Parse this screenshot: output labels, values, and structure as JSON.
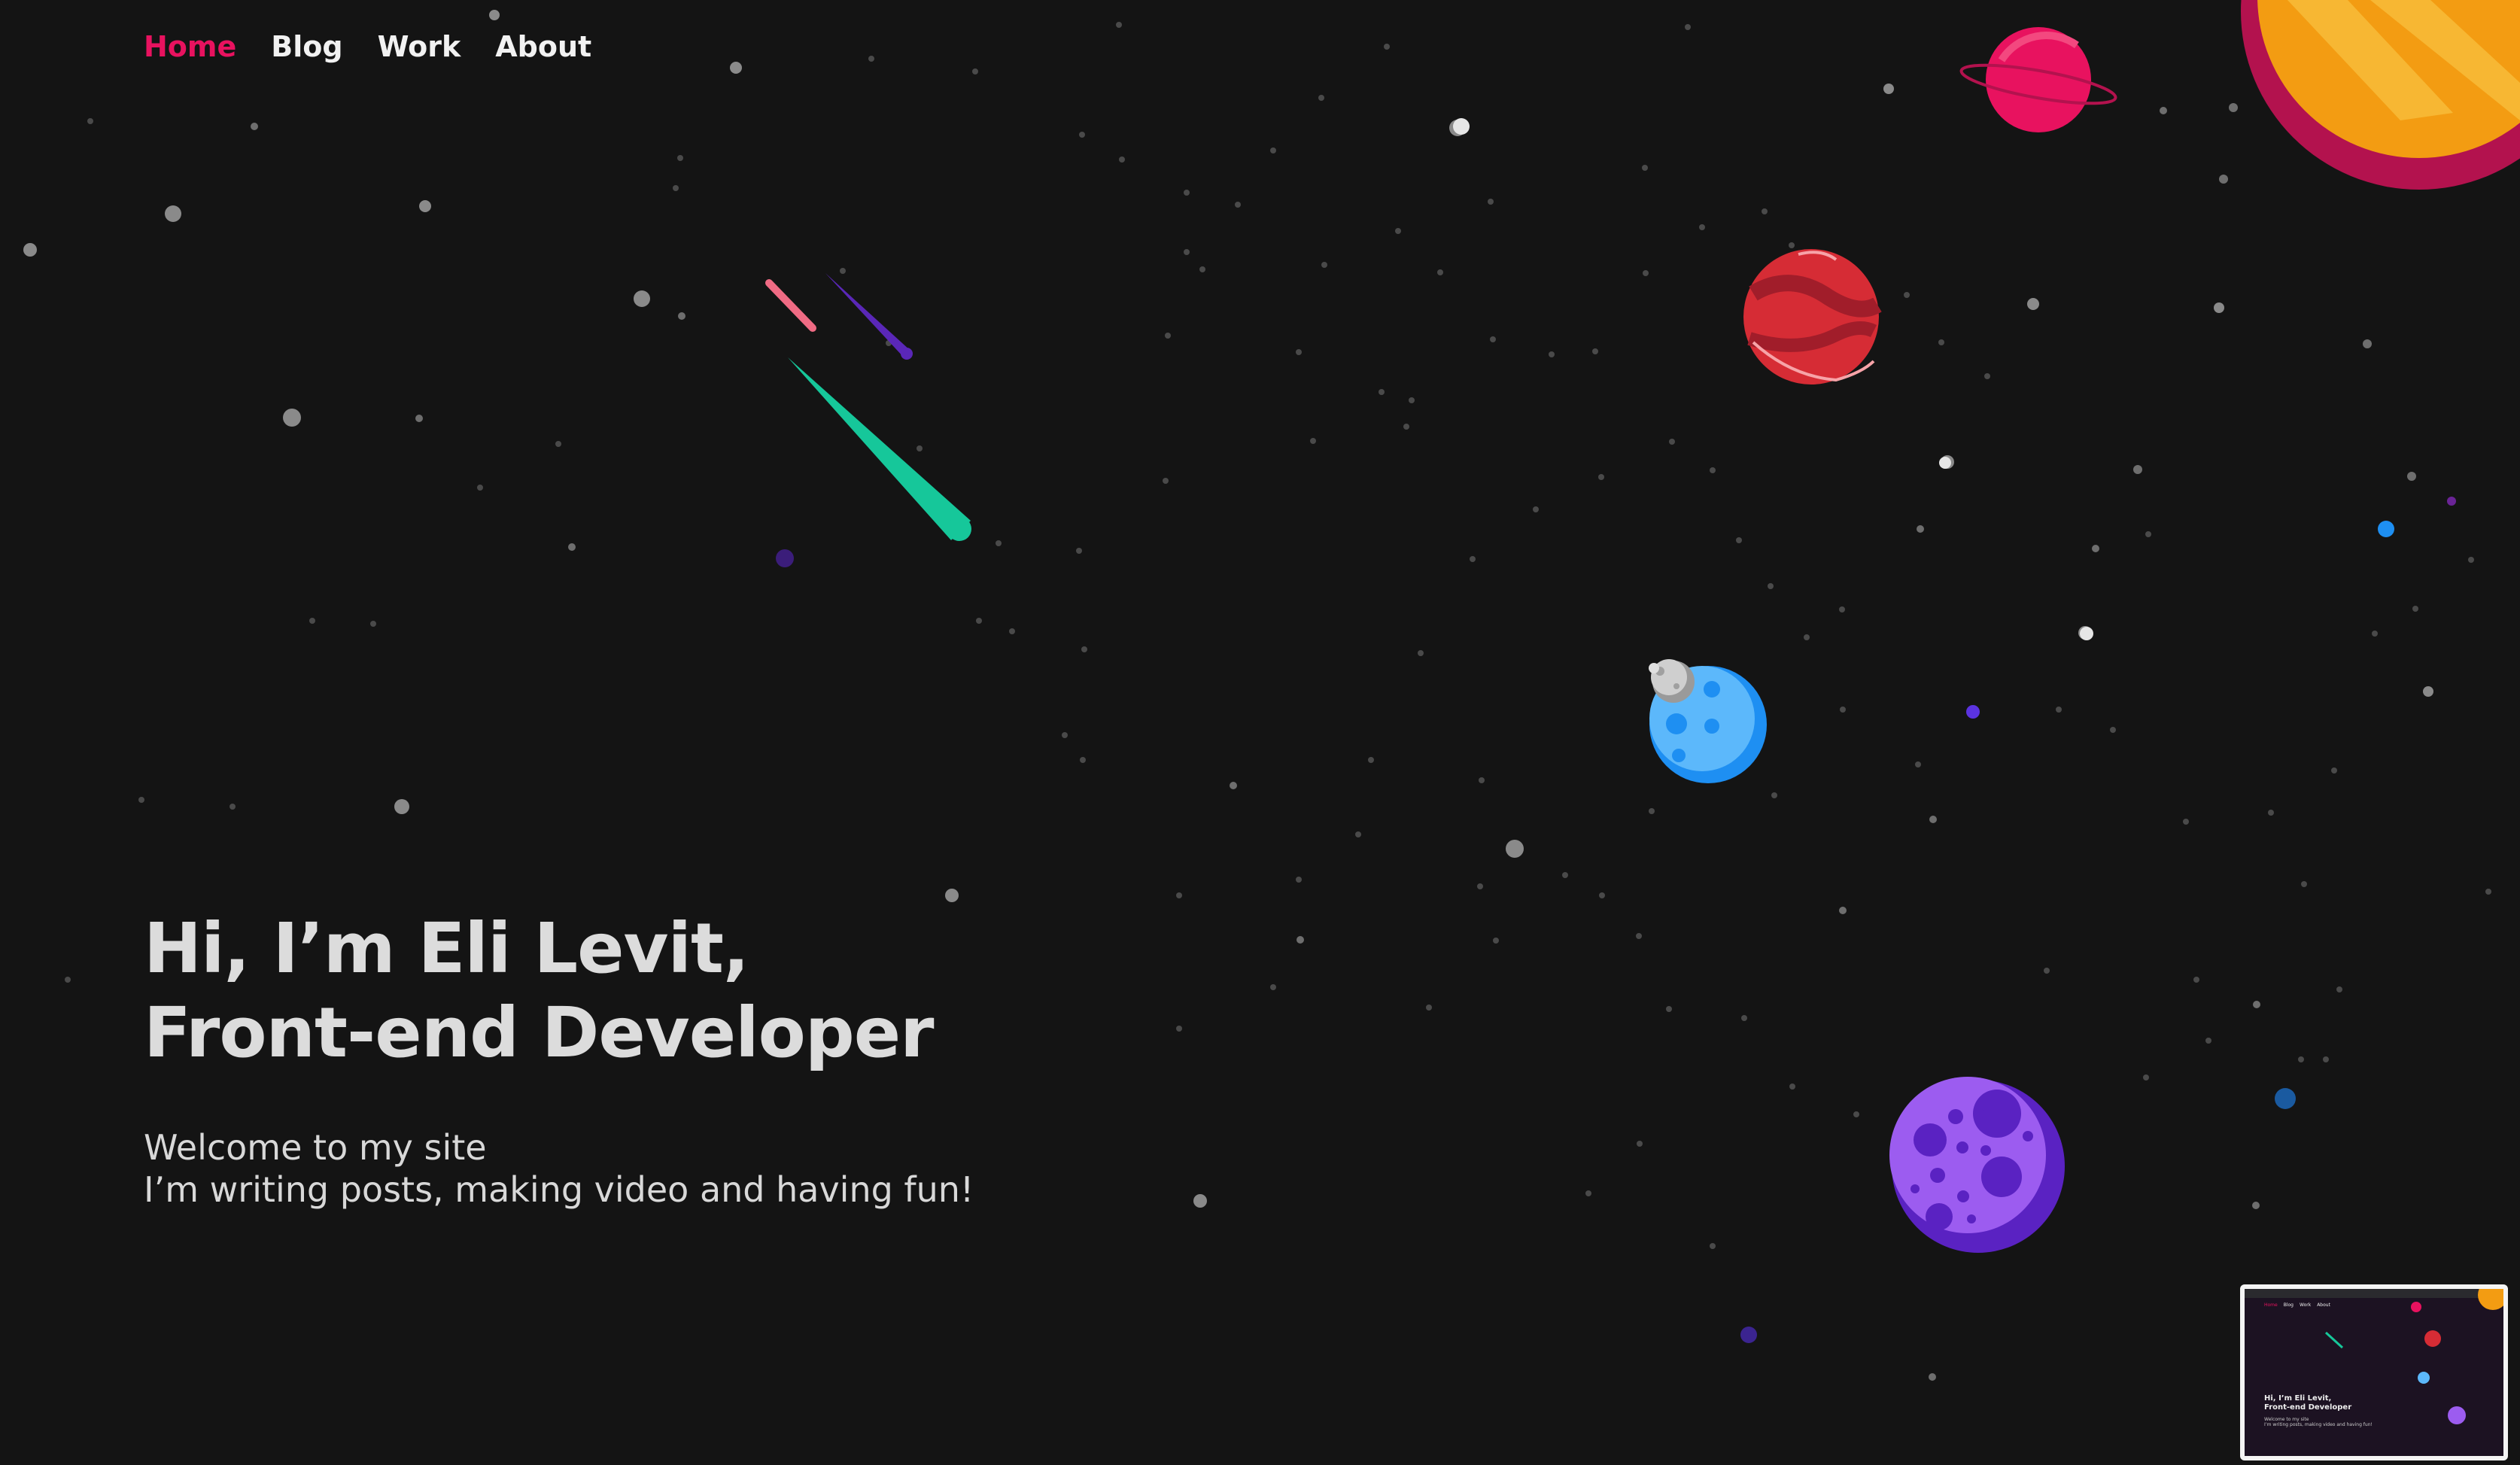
{
  "nav": {
    "items": [
      {
        "label": "Home",
        "active": true
      },
      {
        "label": "Blog",
        "active": false
      },
      {
        "label": "Work",
        "active": false
      },
      {
        "label": "About",
        "active": false
      }
    ]
  },
  "hero": {
    "title_line1": "Hi, I’m Eli Levit,",
    "title_line2": "Front-end Developer",
    "subtitle_line1": "Welcome to my site",
    "subtitle_line2": "I’m writing posts, making video and having fun!"
  },
  "colors": {
    "background": "#141414",
    "accent": "#e8125f",
    "text": "#dcdcdc"
  },
  "decor": [
    "comet-green",
    "comet-purple",
    "comet-pink",
    "ringed-planet-pink",
    "sun-orange",
    "planet-red",
    "planet-blue-with-moon",
    "planet-purple",
    "star-field"
  ],
  "thumbnail": {
    "nav": [
      "Home",
      "Blog",
      "Work",
      "About"
    ],
    "title_line1": "Hi, I’m Eli Levit,",
    "title_line2": "Front-end Developer",
    "subtitle_line1": "Welcome to my site",
    "subtitle_line2": "I’m writing posts, making video and having fun!"
  }
}
